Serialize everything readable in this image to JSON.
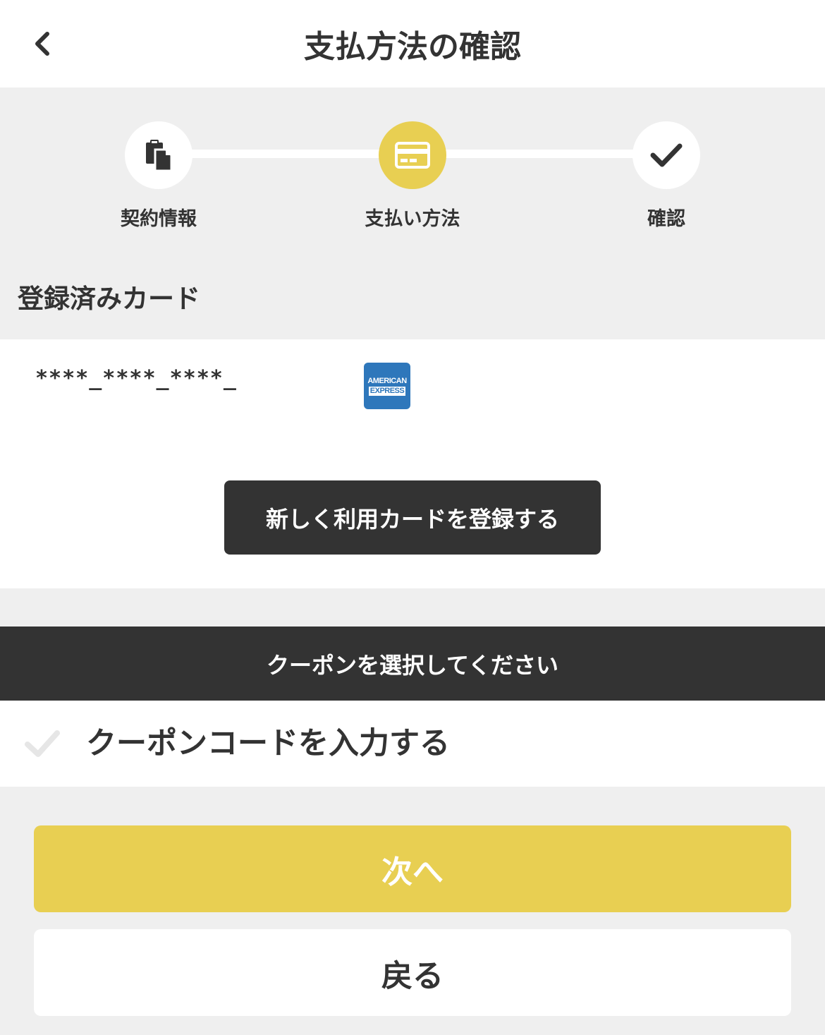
{
  "header": {
    "title": "支払方法の確認",
    "back_icon": "chevron-left-icon"
  },
  "stepper": {
    "steps": [
      {
        "label": "契約情報",
        "icon": "clipboard-icon",
        "active": false
      },
      {
        "label": "支払い方法",
        "icon": "credit-card-icon",
        "active": true
      },
      {
        "label": "確認",
        "icon": "checkmark-icon",
        "active": false
      }
    ]
  },
  "registered_cards": {
    "title": "登録済みカード",
    "card_number": "****_****_****_",
    "brand_line1": "AMERICAN",
    "brand_line2": "EXPRESS",
    "register_button": "新しく利用カードを登録する"
  },
  "coupon": {
    "bar_text": "クーポンを選択してください",
    "enter_code_label": "クーポンコードを入力する"
  },
  "actions": {
    "next": "次へ",
    "back": "戻る"
  },
  "colors": {
    "accent_yellow": "#e8cf52",
    "dark": "#333333",
    "background": "#efefef",
    "amex_blue": "#2e77bb"
  }
}
